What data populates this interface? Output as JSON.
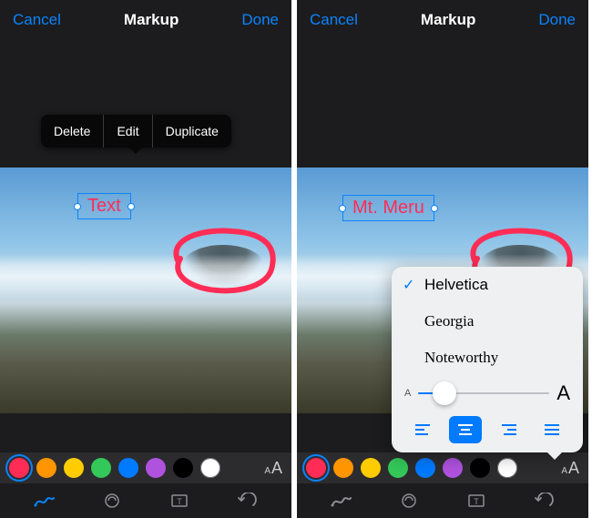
{
  "left": {
    "nav": {
      "cancel": "Cancel",
      "title": "Markup",
      "done": "Done"
    },
    "callout": {
      "delete": "Delete",
      "edit": "Edit",
      "duplicate": "Duplicate"
    },
    "text_annotation": "Text",
    "colors": [
      {
        "hex": "#ff2d55",
        "selected": true
      },
      {
        "hex": "#ff9500",
        "selected": false
      },
      {
        "hex": "#ffcc00",
        "selected": false
      },
      {
        "hex": "#34c759",
        "selected": false
      },
      {
        "hex": "#007aff",
        "selected": false
      },
      {
        "hex": "#af52de",
        "selected": false
      },
      {
        "hex": "#000000",
        "selected": false
      },
      {
        "hex": "#ffffff",
        "selected": false
      }
    ]
  },
  "right": {
    "nav": {
      "cancel": "Cancel",
      "title": "Markup",
      "done": "Done"
    },
    "text_annotation": "Mt. Meru",
    "font_picker": {
      "fonts": [
        {
          "name": "Helvetica",
          "selected": true
        },
        {
          "name": "Georgia",
          "selected": false
        },
        {
          "name": "Noteworthy",
          "selected": false
        }
      ],
      "size_small_label": "A",
      "size_large_label": "A",
      "alignments": [
        "left",
        "center",
        "right",
        "justify"
      ],
      "alignment_selected": "center"
    },
    "colors": [
      {
        "hex": "#ff2d55",
        "selected": true
      },
      {
        "hex": "#ff9500",
        "selected": false
      },
      {
        "hex": "#ffcc00",
        "selected": false
      },
      {
        "hex": "#34c759",
        "selected": false
      },
      {
        "hex": "#007aff",
        "selected": false
      },
      {
        "hex": "#af52de",
        "selected": false
      },
      {
        "hex": "#000000",
        "selected": false
      },
      {
        "hex": "#ffffff",
        "selected": false
      }
    ]
  }
}
